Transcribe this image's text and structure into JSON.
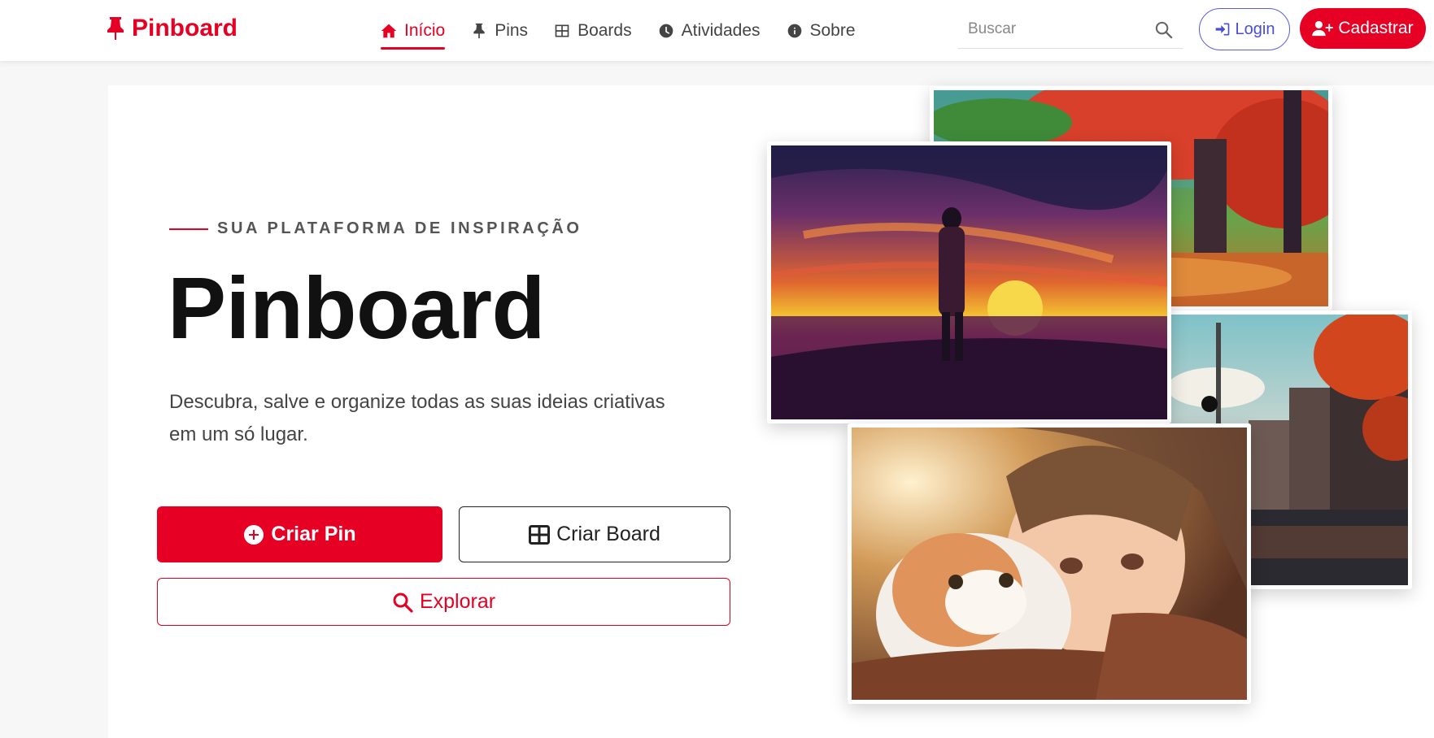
{
  "brand": {
    "name": "Pinboard"
  },
  "nav": {
    "items": [
      {
        "label": "Início",
        "icon": "home-icon",
        "active": true
      },
      {
        "label": "Pins",
        "icon": "pin-icon",
        "active": false
      },
      {
        "label": "Boards",
        "icon": "grid-icon",
        "active": false
      },
      {
        "label": "Atividades",
        "icon": "clock-icon",
        "active": false
      },
      {
        "label": "Sobre",
        "icon": "info-icon",
        "active": false
      }
    ]
  },
  "search": {
    "placeholder": "Buscar",
    "value": ""
  },
  "auth": {
    "login_label": "Login",
    "signup_label": "Cadastrar"
  },
  "hero": {
    "eyebrow": "SUA PLATAFORMA DE INSPIRAÇÃO",
    "title": "Pinboard",
    "description": "Descubra, salve e organize todas as suas ideias criativas em um só lugar.",
    "create_pin_label": "Criar Pin",
    "create_board_label": "Criar Board",
    "explore_label": "Explorar"
  },
  "colors": {
    "brand": "#e60023",
    "login_accent": "#4a4ed0",
    "text_dark": "#111111",
    "text_muted": "#444444"
  }
}
